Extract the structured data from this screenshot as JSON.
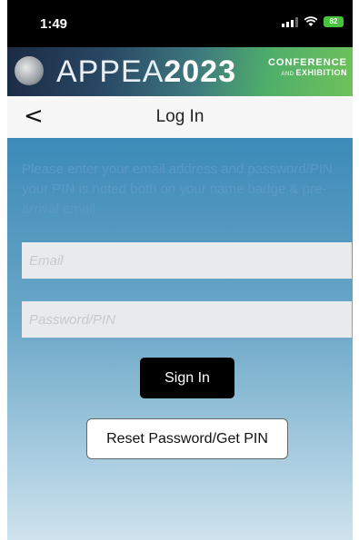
{
  "status_bar": {
    "time": "1:49",
    "battery": "82"
  },
  "banner": {
    "title_thin": "APPEA",
    "title_year": "2023",
    "subtitle_line1": "CONFERENCE",
    "subtitle_and": "AND",
    "subtitle_line2": "EXHIBITION"
  },
  "nav": {
    "back_glyph": "<",
    "title": "Log In"
  },
  "login": {
    "intro": "Please enter your email address and password/PIN your PIN is noted both on your name badge & pre-arrival email",
    "email_placeholder": "Email",
    "password_placeholder": "Password/PIN",
    "signin_label": "Sign In",
    "reset_label": "Reset Password/Get PIN"
  }
}
